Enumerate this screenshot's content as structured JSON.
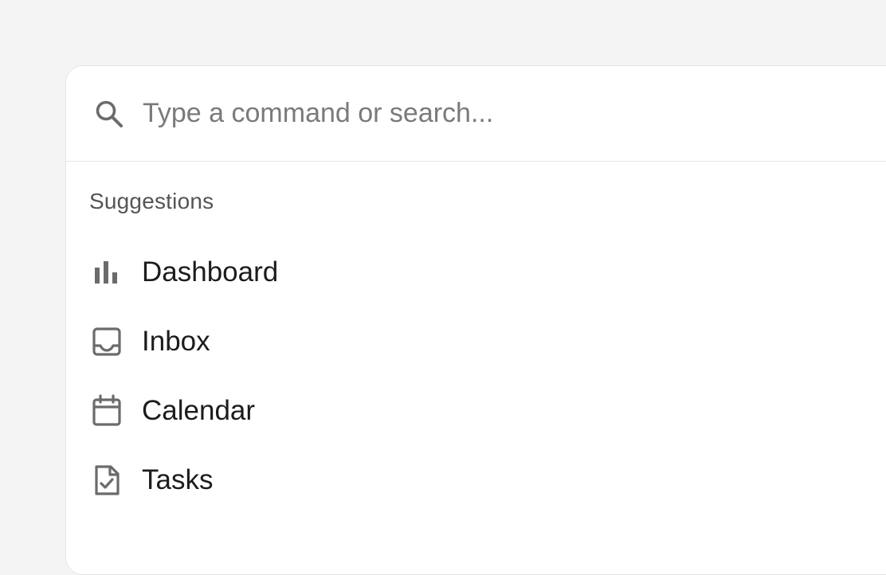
{
  "search": {
    "placeholder": "Type a command or search...",
    "value": "",
    "icon": "search-icon"
  },
  "suggestions": {
    "heading": "Suggestions",
    "items": [
      {
        "label": "Dashboard",
        "icon": "bar-chart-icon"
      },
      {
        "label": "Inbox",
        "icon": "inbox-icon"
      },
      {
        "label": "Calendar",
        "icon": "calendar-icon"
      },
      {
        "label": "Tasks",
        "icon": "task-document-icon"
      }
    ]
  },
  "colors": {
    "background": "#f4f4f4",
    "panel": "#ffffff",
    "border": "#e4e4e4",
    "icon": "#6b6b6b",
    "text": "#1c1c1c",
    "muted": "#7a7a7a"
  }
}
